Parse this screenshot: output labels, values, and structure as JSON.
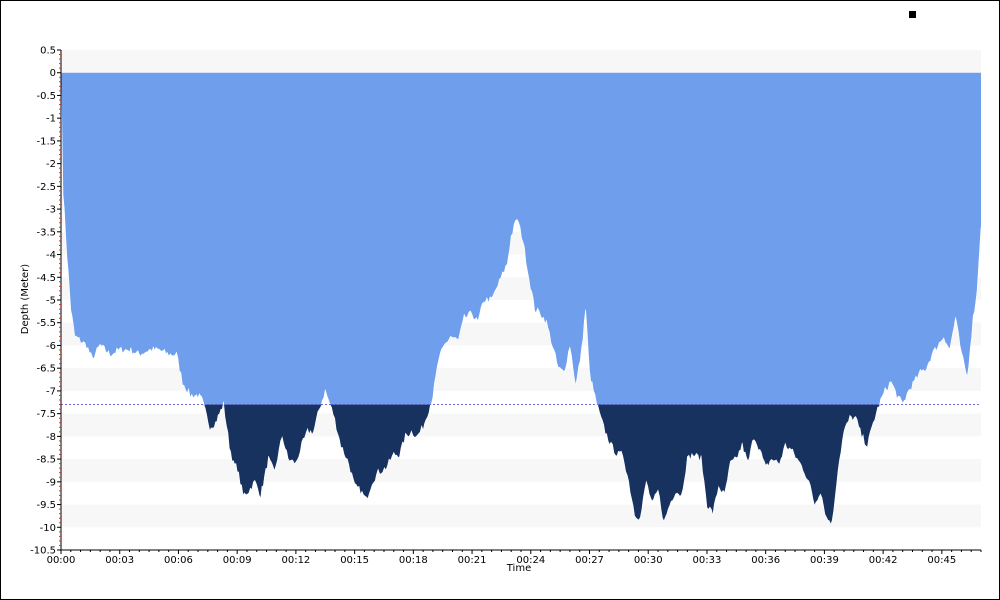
{
  "colors": {
    "background": "#ffffff",
    "band": "#f7f7f7",
    "water": "#6f9fec",
    "deep": "#17325f",
    "reference_line": "#6b6bd4",
    "axis": "#000000"
  },
  "chart_data": {
    "type": "area",
    "title": "",
    "xlabel": "Time",
    "ylabel": "Depth (Meter)",
    "xlim_minutes": [
      0,
      47
    ],
    "ylim": [
      -10.5,
      0.5
    ],
    "reference_depth": -7.3,
    "x_tick_labels": [
      "00:00",
      "00:03",
      "00:06",
      "00:09",
      "00:12",
      "00:15",
      "00:18",
      "00:21",
      "00:24",
      "00:27",
      "00:30",
      "00:33",
      "00:36",
      "00:39",
      "00:42",
      "00:45"
    ],
    "x_tick_minutes": [
      0,
      3,
      6,
      9,
      12,
      15,
      18,
      21,
      24,
      27,
      30,
      33,
      36,
      39,
      42,
      45
    ],
    "y_tick_labels": [
      "0.5",
      "0",
      "-0.5",
      "-1",
      "-1.5",
      "-2",
      "-2.5",
      "-3",
      "-3.5",
      "-4",
      "-4.5",
      "-5",
      "-5.5",
      "-6",
      "-6.5",
      "-7",
      "-7.5",
      "-8",
      "-8.5",
      "-9",
      "-9.5",
      "-10",
      "-10.5"
    ],
    "y_tick_values": [
      0.5,
      0,
      -0.5,
      -1,
      -1.5,
      -2,
      -2.5,
      -3,
      -3.5,
      -4,
      -4.5,
      -5,
      -5.5,
      -6,
      -6.5,
      -7,
      -7.5,
      -8,
      -8.5,
      -9,
      -9.5,
      -10,
      -10.5
    ],
    "series": [
      {
        "time_minutes": [
          0,
          0.1,
          0.3,
          0.5,
          0.7,
          1.0,
          1.3,
          1.6,
          2.0,
          2.5,
          3.0,
          3.5,
          4.0,
          4.5,
          5.0,
          5.5,
          5.9,
          6.2,
          6.6,
          7.0,
          7.2,
          7.6,
          7.9,
          8.1,
          8.3,
          8.6,
          8.8,
          9.0,
          9.3,
          9.6,
          9.9,
          10.2,
          10.4,
          10.6,
          10.9,
          11.3,
          11.6,
          12.0,
          12.3,
          12.6,
          12.9,
          13.2,
          13.5,
          13.9,
          14.3,
          14.7,
          15.0,
          15.3,
          15.6,
          15.9,
          16.2,
          16.6,
          17.0,
          17.3,
          17.6,
          17.9,
          18.2,
          18.5,
          18.8,
          19.0,
          19.3,
          19.6,
          19.9,
          20.3,
          20.6,
          21.0,
          21.3,
          21.6,
          22.0,
          22.4,
          22.8,
          23.0,
          23.3,
          23.6,
          23.9,
          24.2,
          24.5,
          24.8,
          25.1,
          25.4,
          25.7,
          26.0,
          26.3,
          26.6,
          26.8,
          27.0,
          27.2,
          27.5,
          27.8,
          28.1,
          28.4,
          28.7,
          29.0,
          29.3,
          29.6,
          29.9,
          30.2,
          30.5,
          30.8,
          31.1,
          31.4,
          31.7,
          32.0,
          32.3,
          32.7,
          33.0,
          33.3,
          33.6,
          33.9,
          34.2,
          34.5,
          34.8,
          35.1,
          35.4,
          35.7,
          36.0,
          36.3,
          36.7,
          37.0,
          37.3,
          37.6,
          37.9,
          38.2,
          38.5,
          38.8,
          39.1,
          39.4,
          39.7,
          40.0,
          40.3,
          40.6,
          40.9,
          41.2,
          41.5,
          41.8,
          42.1,
          42.4,
          42.7,
          43.0,
          43.3,
          43.6,
          43.9,
          44.2,
          44.5,
          44.8,
          45.1,
          45.4,
          45.7,
          46.0,
          46.3,
          46.6,
          46.8,
          47.0
        ],
        "depth_m": [
          0,
          -2.6,
          -4.0,
          -5.2,
          -5.8,
          -5.9,
          -6.0,
          -6.3,
          -6.0,
          -6.2,
          -6.1,
          -6.1,
          -6.2,
          -6.1,
          -6.1,
          -6.2,
          -6.2,
          -6.8,
          -7.1,
          -7.1,
          -7.2,
          -7.8,
          -7.7,
          -7.5,
          -7.3,
          -8.2,
          -8.6,
          -8.7,
          -9.3,
          -9.2,
          -9.0,
          -9.3,
          -8.9,
          -8.5,
          -8.8,
          -8.0,
          -8.5,
          -8.6,
          -8.2,
          -7.9,
          -7.9,
          -7.4,
          -7.0,
          -7.5,
          -8.2,
          -8.6,
          -9.1,
          -9.2,
          -9.4,
          -9.0,
          -8.8,
          -8.7,
          -8.4,
          -8.4,
          -8.0,
          -7.9,
          -8.0,
          -7.8,
          -7.4,
          -7.1,
          -6.3,
          -6.0,
          -5.8,
          -5.9,
          -5.4,
          -5.3,
          -5.5,
          -5.0,
          -5.0,
          -4.6,
          -4.2,
          -3.6,
          -3.2,
          -3.7,
          -4.5,
          -5.2,
          -5.3,
          -5.5,
          -6.0,
          -6.5,
          -6.6,
          -6.0,
          -6.9,
          -6.1,
          -5.2,
          -6.6,
          -7.0,
          -7.5,
          -7.9,
          -8.2,
          -8.4,
          -8.4,
          -9.0,
          -9.7,
          -9.8,
          -9.0,
          -9.5,
          -9.2,
          -9.9,
          -9.5,
          -9.2,
          -9.3,
          -8.5,
          -8.4,
          -8.5,
          -9.5,
          -9.7,
          -9.1,
          -9.3,
          -8.6,
          -8.5,
          -8.2,
          -8.6,
          -8.0,
          -8.3,
          -8.7,
          -8.5,
          -8.6,
          -8.2,
          -8.3,
          -8.5,
          -8.7,
          -9.0,
          -9.5,
          -9.2,
          -9.8,
          -9.9,
          -8.7,
          -7.9,
          -7.6,
          -7.6,
          -8.0,
          -8.2,
          -7.7,
          -7.3,
          -7.0,
          -6.8,
          -7.1,
          -7.3,
          -7.0,
          -6.8,
          -6.6,
          -6.5,
          -6.2,
          -6.0,
          -5.8,
          -6.1,
          -5.4,
          -6.2,
          -6.7,
          -5.4,
          -4.8,
          -3.4
        ]
      }
    ]
  }
}
